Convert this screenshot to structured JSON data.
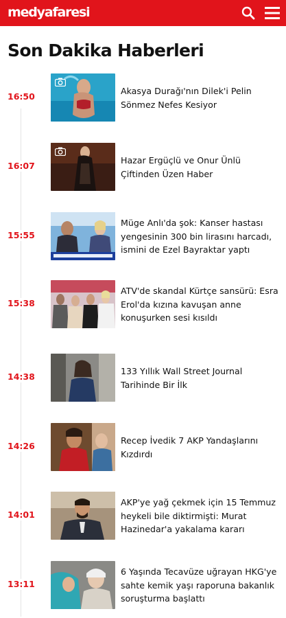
{
  "header": {
    "logo": "medyafaresi",
    "search_icon": "search-icon",
    "menu_icon": "hamburger-menu-icon",
    "brand_color": "#e1141b"
  },
  "page_title": "Son Dakika Haberleri",
  "news": [
    {
      "time": "16:50",
      "title": "Akasya Durağı'nın Dilek'i Pelin Sönmez Nefes Kesiyor",
      "gallery": true
    },
    {
      "time": "16:07",
      "title": "Hazar Ergüçlü ve Onur Ünlü Çiftinden Üzen Haber",
      "gallery": true
    },
    {
      "time": "15:55",
      "title": "Müge Anlı'da şok: Kanser hastası yengesinin 300 bin lirasını harcadı, ismini de Ezel Bayraktar yaptı",
      "gallery": false
    },
    {
      "time": "15:38",
      "title": "ATV'de skandal Kürtçe sansürü: Esra Erol'da kızına kavuşan anne konuşurken sesi kısıldı",
      "gallery": false
    },
    {
      "time": "14:38",
      "title": "133 Yıllık Wall Street Journal Tarihinde Bir İlk",
      "gallery": false
    },
    {
      "time": "14:26",
      "title": "Recep İvedik 7 AKP Yandaşlarını Kızdırdı",
      "gallery": false
    },
    {
      "time": "14:01",
      "title": "AKP'ye yağ çekmek için 15 Temmuz heykeli bile diktirmişti: Murat Hazinedar'a yakalama kararı",
      "gallery": false
    },
    {
      "time": "13:11",
      "title": "6 Yaşında Tecavüze uğrayan HKG'ye sahte kemik yaşı raporuna bakanlık soruşturma başlattı",
      "gallery": false
    }
  ]
}
